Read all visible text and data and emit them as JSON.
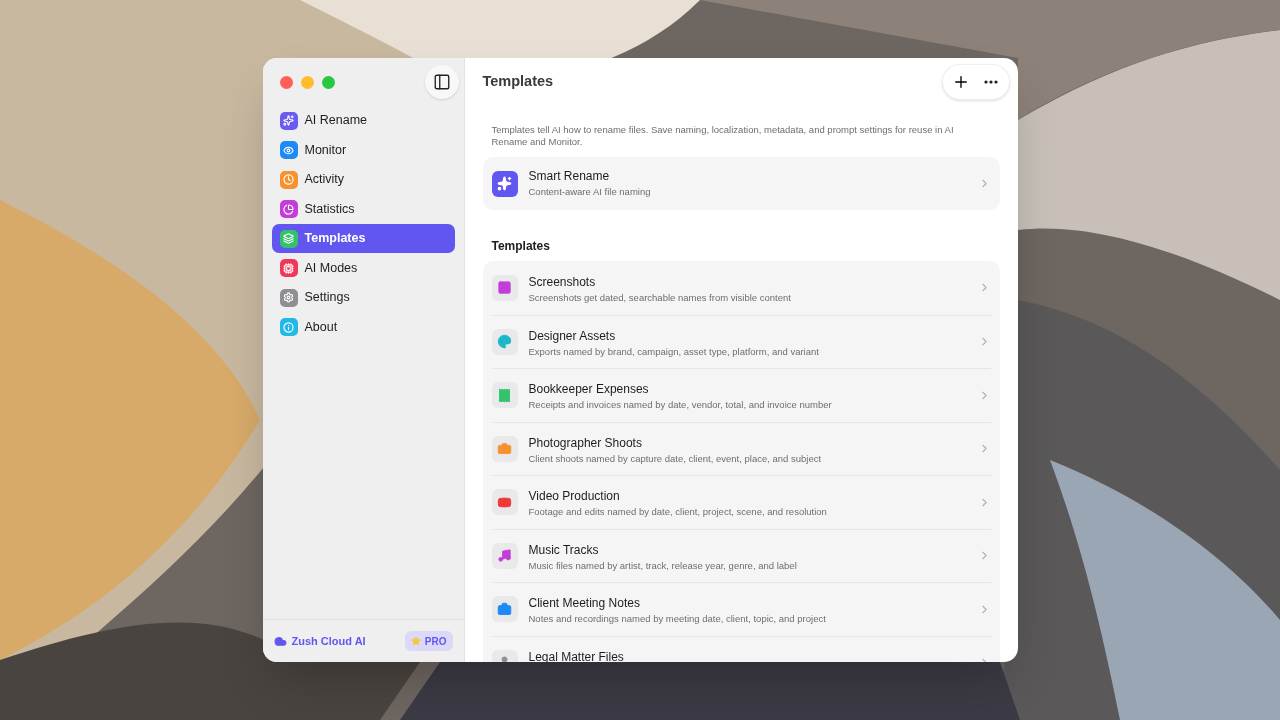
{
  "sidebar": {
    "items": [
      {
        "label": "AI Rename",
        "selected": false,
        "color": "#6a5cf0"
      },
      {
        "label": "Monitor",
        "selected": false,
        "color": "#1e8af5"
      },
      {
        "label": "Activity",
        "selected": false,
        "color": "#f5922e"
      },
      {
        "label": "Statistics",
        "selected": false,
        "color": "#c13ed8"
      },
      {
        "label": "Templates",
        "selected": true,
        "color": "#34c36a"
      },
      {
        "label": "AI Modes",
        "selected": false,
        "color": "#f0385a"
      },
      {
        "label": "Settings",
        "selected": false,
        "color": "#8e8e93"
      },
      {
        "label": "About",
        "selected": false,
        "color": "#22b8e8"
      }
    ],
    "footer": {
      "cloud": "Zush Cloud AI",
      "badge": "PRO"
    }
  },
  "main": {
    "title": "Templates",
    "description": "Templates tell AI how to rename files. Save naming, localization, metadata, and prompt settings for reuse in AI Rename and Monitor.",
    "featured": {
      "title": "Smart Rename",
      "subtitle": "Content-aware AI file naming"
    },
    "section_title": "Templates",
    "templates": [
      {
        "title": "Screenshots",
        "subtitle": "Screenshots get dated, searchable names from visible content",
        "color": "#c13ed8"
      },
      {
        "title": "Designer Assets",
        "subtitle": "Exports named by brand, campaign, asset type, platform, and variant",
        "color": "#1bb8c8"
      },
      {
        "title": "Bookkeeper Expenses",
        "subtitle": "Receipts and invoices named by date, vendor, total, and invoice number",
        "color": "#34c36a"
      },
      {
        "title": "Photographer Shoots",
        "subtitle": "Client shoots named by capture date, client, event, place, and subject",
        "color": "#f5922e"
      },
      {
        "title": "Video Production",
        "subtitle": "Footage and edits named by date, client, project, scene, and resolution",
        "color": "#ee3a3a"
      },
      {
        "title": "Music Tracks",
        "subtitle": "Music files named by artist, track, release year, genre, and label",
        "color": "#c13ed8"
      },
      {
        "title": "Client Meeting Notes",
        "subtitle": "Notes and recordings named by meeting date, client, topic, and project",
        "color": "#1e8af5"
      },
      {
        "title": "Legal Matter Files",
        "color": "#8e8e93"
      }
    ]
  }
}
